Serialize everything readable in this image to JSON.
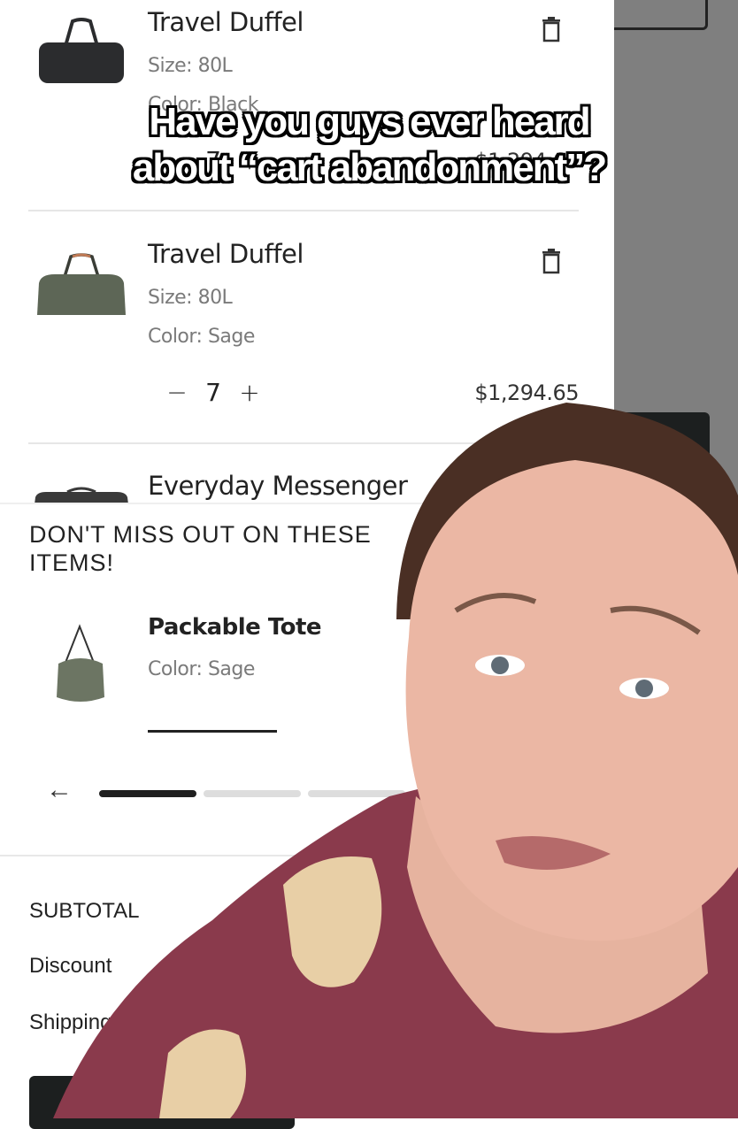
{
  "cart": {
    "items": [
      {
        "name": "Travel Duffel",
        "size": "Size: 80L",
        "color": "Color: Black",
        "quantity": "7",
        "price": "$1,294.65",
        "image_color": "#2b2c2e"
      },
      {
        "name": "Travel Duffel",
        "size": "Size: 80L",
        "color": "Color: Sage",
        "quantity": "7",
        "price": "$1,294.65",
        "image_color": "#5d6656"
      },
      {
        "name": "Everyday Messenger",
        "image_color": "#3a3a3a"
      }
    ],
    "qty_minus": "−",
    "qty_plus": "+"
  },
  "upsell": {
    "title": "DON'T MISS OUT ON THESE ITEMS!",
    "item": {
      "name": "Packable Tote",
      "color": "Color: Sage",
      "image_color": "#6c7563"
    },
    "prev_icon": "←",
    "carousel": {
      "pages": 3,
      "active": 1
    }
  },
  "summary": {
    "subtotal_label": "SUBTOTAL",
    "discount_label": "Discount",
    "shipping_label": "Shipping"
  },
  "overlay": {
    "caption_line1": "Have you guys ever heard",
    "caption_line2": "about “cart abandonment”?"
  },
  "colors": {
    "backdrop": "#7f7f7f",
    "button_dark": "#1c1f1f",
    "text_primary": "#222222",
    "text_secondary": "#7a7a7a",
    "sweater": "#8a3a4c",
    "skin": "#e8b3a0",
    "hair": "#4a2f24"
  }
}
